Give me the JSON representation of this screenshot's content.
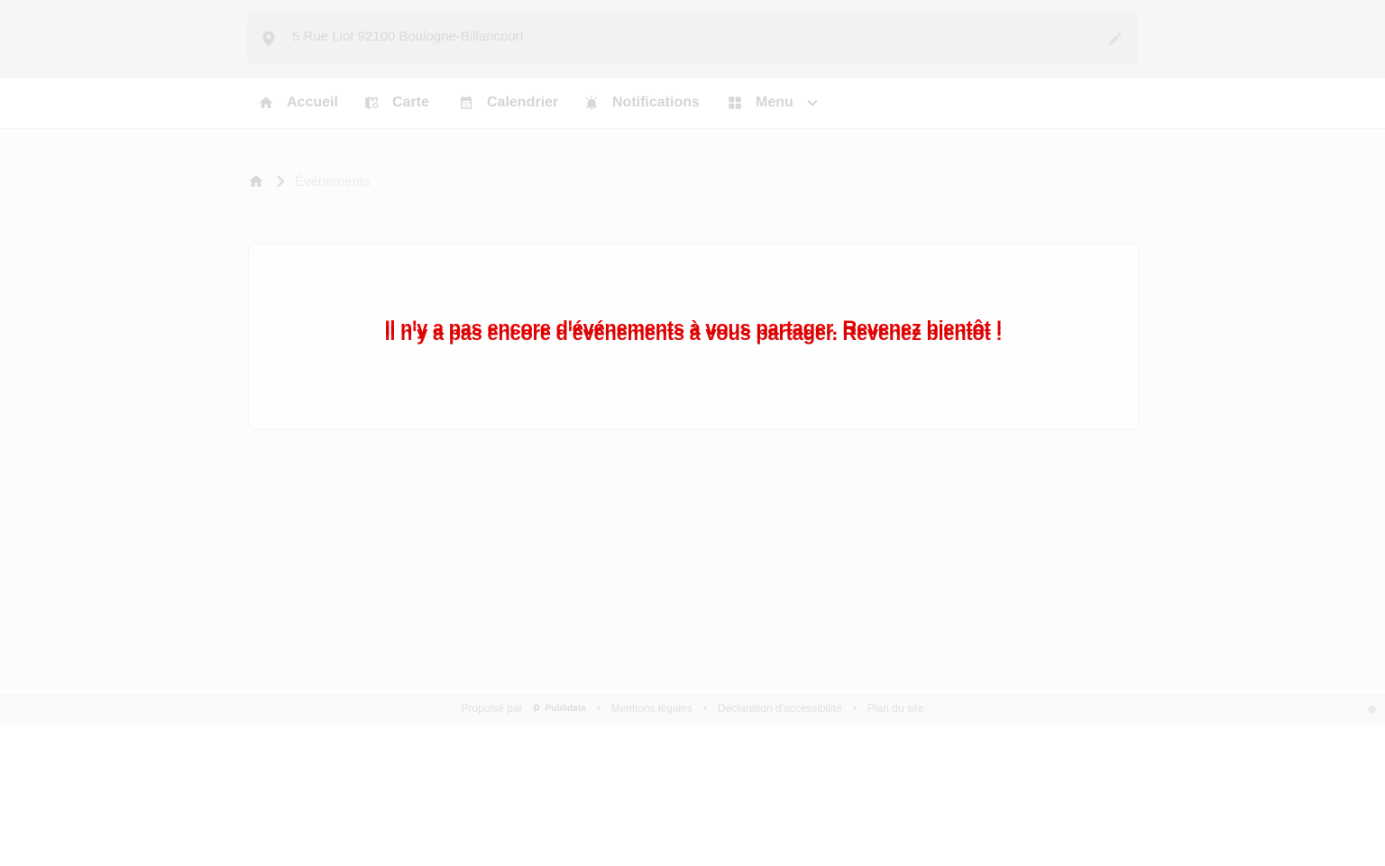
{
  "header": {
    "address": "5 Rue Liot 92100 Boulogne-Billancourt"
  },
  "nav": {
    "items": [
      {
        "label": "Accueil",
        "icon": "home-icon"
      },
      {
        "label": "Carte",
        "icon": "map-icon"
      },
      {
        "label": "Calendrier",
        "icon": "calendar-icon"
      },
      {
        "label": "Notifications",
        "icon": "alarm-icon"
      },
      {
        "label": "Menu",
        "icon": "grid-icon"
      }
    ]
  },
  "breadcrumb": {
    "current": "Événements"
  },
  "main": {
    "empty_message": "Il n'y a pas encore d'événements à vous partager. Revenez bientôt !"
  },
  "footer": {
    "powered_by": "Propulsé par",
    "brand": "Publidata",
    "links": [
      "Mentions légales",
      "Déclaration d'accessibilité",
      "Plan du site"
    ]
  },
  "colors": {
    "message": "#e60000",
    "muted": "#d4d4d4"
  }
}
